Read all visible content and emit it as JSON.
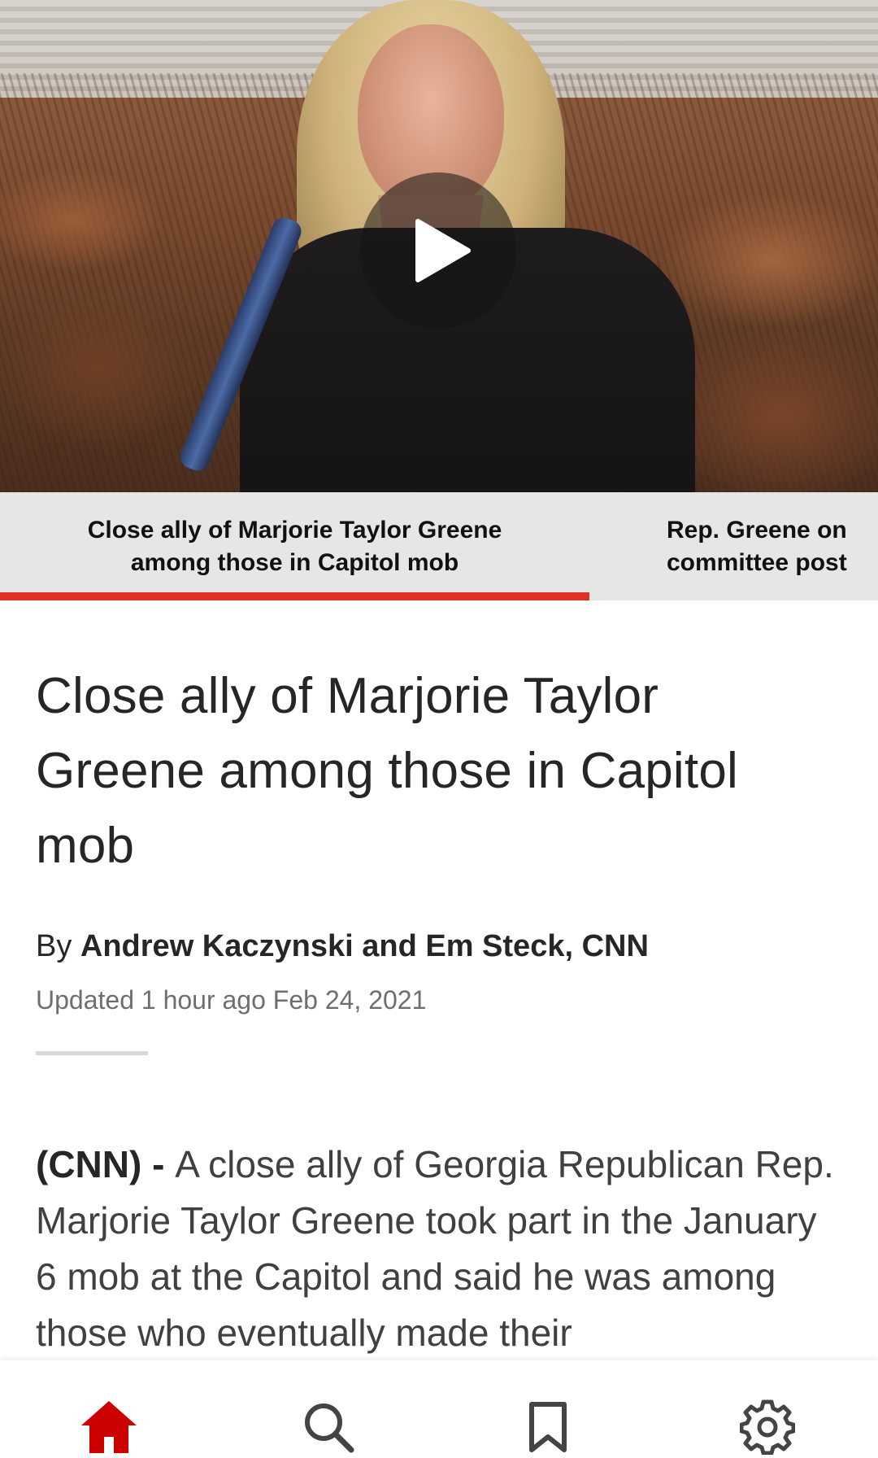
{
  "video": {
    "play_icon": "play-icon"
  },
  "carousel": {
    "items": [
      {
        "caption": "Close ally of Marjorie Taylor Greene\namong those in Capitol mob",
        "active": true
      },
      {
        "caption": "Rep. Greene on\ncommittee post",
        "active": false
      }
    ],
    "accent_color": "#e03127"
  },
  "article": {
    "headline": "Close ally of Marjorie Taylor Greene among those in Capitol mob",
    "byline_prefix": "By ",
    "byline_authors": "Andrew Kaczynski and Em Steck, CNN",
    "updated": "Updated 1 hour ago Feb 24, 2021",
    "lead": "(CNN) - ",
    "body": "A close ally of Georgia Republican Rep. Marjorie Taylor Greene took part in the January 6 mob at the Capitol and said he was among those who eventually made their"
  },
  "bottom_nav": {
    "items": [
      {
        "name": "home",
        "icon": "home-icon",
        "color": "#cc0000"
      },
      {
        "name": "search",
        "icon": "search-icon",
        "color": "#444444"
      },
      {
        "name": "saved",
        "icon": "bookmark-icon",
        "color": "#444444"
      },
      {
        "name": "settings",
        "icon": "gear-icon",
        "color": "#444444"
      }
    ]
  }
}
